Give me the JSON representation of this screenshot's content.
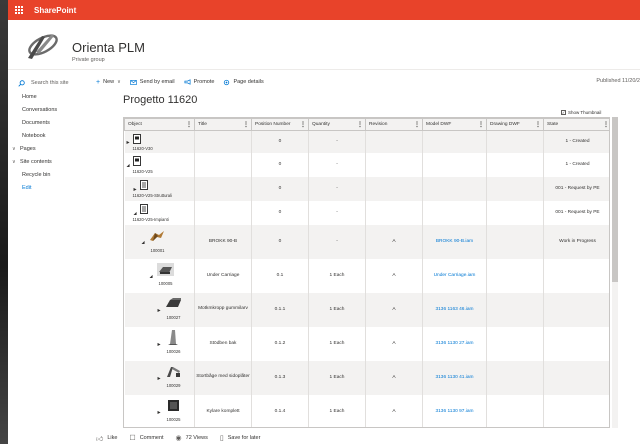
{
  "suite": {
    "title": "SharePoint"
  },
  "site": {
    "name": "Orienta PLM",
    "type": "Private group"
  },
  "nav": {
    "search_placeholder": "Search this site",
    "items": [
      {
        "label": "Home"
      },
      {
        "label": "Conversations"
      },
      {
        "label": "Documents"
      },
      {
        "label": "Notebook"
      },
      {
        "label": "Pages",
        "chevron": "∨"
      },
      {
        "label": "Site contents",
        "chevron": "∨"
      },
      {
        "label": "Recycle bin"
      },
      {
        "label": "Edit"
      }
    ]
  },
  "cmdbar": {
    "new": "New",
    "send": "Send by email",
    "promote": "Promote",
    "details": "Page details",
    "published": "Published 11/20/2"
  },
  "page": {
    "title": "Progetto 11620"
  },
  "table": {
    "show_thumbnail": "Show Thumbnail",
    "columns": [
      "Object",
      "Title",
      "Position Number",
      "Quantity",
      "Revision",
      "Model DWF",
      "Drawing DWF",
      "State"
    ],
    "rows": [
      {
        "label": "11620-V30",
        "title": "",
        "pos": "0",
        "qty": "-",
        "rev": "",
        "model": "",
        "drawing": "",
        "state": "1 - Created"
      },
      {
        "label": "11620-V25",
        "title": "",
        "pos": "0",
        "qty": "-",
        "rev": "",
        "model": "",
        "drawing": "",
        "state": "1 - Created"
      },
      {
        "label": "11620-V25-Strutturali",
        "title": "",
        "pos": "0",
        "qty": "-",
        "rev": "",
        "model": "",
        "drawing": "",
        "state": "001 - Request by PE"
      },
      {
        "label": "11620-V25-Impianti",
        "title": "",
        "pos": "0",
        "qty": "-",
        "rev": "",
        "model": "",
        "drawing": "",
        "state": "001 - Request by PE"
      },
      {
        "label": "100001",
        "title": "BROKK 90-B",
        "pos": "0",
        "qty": "-",
        "rev": "A",
        "model": "BROKK 90-B.iam",
        "drawing": "",
        "state": "Work in Progress"
      },
      {
        "label": "100005",
        "title": "Under Carriage",
        "pos": "0.1",
        "qty": "1 Each",
        "rev": "A",
        "model": "Under Carriage.iam",
        "drawing": "",
        "state": ""
      },
      {
        "label": "100027",
        "title": "Motkmkropp gummilarv",
        "pos": "0.1.1",
        "qty": "1 Each",
        "rev": "A",
        "model": "3136 1163 46.iam",
        "drawing": "",
        "state": ""
      },
      {
        "label": "100026",
        "title": "Stödben bak",
        "pos": "0.1.2",
        "qty": "1 Each",
        "rev": "A",
        "model": "3136 1130 27.iam",
        "drawing": "",
        "state": ""
      },
      {
        "label": "100029",
        "title": "Stortbåge med sidoplåter",
        "pos": "0.1.3",
        "qty": "1 Each",
        "rev": "A",
        "model": "3136 1130 41.iam",
        "drawing": "",
        "state": ""
      },
      {
        "label": "100025",
        "title": "Kylare komplett",
        "pos": "0.1.4",
        "qty": "1 Each",
        "rev": "A",
        "model": "3136 1130 97.iam",
        "drawing": "",
        "state": ""
      }
    ]
  },
  "footer": {
    "like": "Like",
    "comment": "Comment",
    "views": "72 Views",
    "save": "Save for later"
  },
  "colors": {
    "suite_bar": "#e8432a",
    "accent": "#0078d4"
  }
}
